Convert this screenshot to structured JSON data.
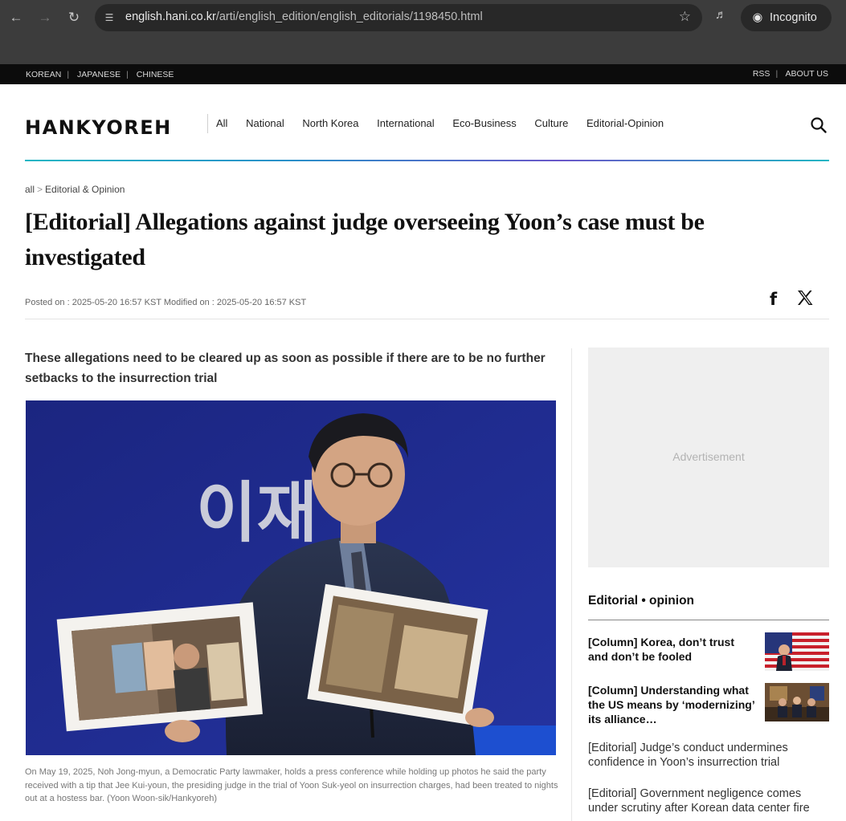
{
  "browser": {
    "url_host": "english.hani.co.kr",
    "url_path": "/arti/english_edition/english_editorials/1198450.html",
    "incognito_label": "Incognito"
  },
  "topbar": {
    "languages": [
      "KOREAN",
      "JAPANESE",
      "CHINESE"
    ],
    "links": [
      "RSS",
      "ABOUT US"
    ]
  },
  "header": {
    "logo": "HANKYOREH",
    "nav": [
      "All",
      "National",
      "North Korea",
      "International",
      "Eco-Business",
      "Culture",
      "Editorial-Opinion"
    ]
  },
  "article": {
    "breadcrumb": [
      "all",
      "Editorial & Opinion"
    ],
    "title": "[Editorial] Allegations against judge overseeing Yoon’s case must be investigated",
    "posted": "Posted on : 2025-05-20 16:57 KST Modified on : 2025-05-20 16:57 KST",
    "subhead": "These allegations need to be cleared up as soon as possible if there are to be no further setbacks to the insurrection trial",
    "photo_sign_text": "이재",
    "caption": "On May 19, 2025, Noh Jong-myun, a Democratic Party lawmaker, holds a press conference while holding up photos he said the party received with a tip that Jee Kui-youn, the presiding judge in the trial of Yoon Suk-yeol on insurrection charges, had been treated to nights out at a hostess bar. (Yoon Woon-sik/Hankyoreh)"
  },
  "sidebar": {
    "ad_label": "Advertisement",
    "heading": "Editorial • opinion",
    "items": [
      {
        "text": "[Column] Korea, don’t trust and don’t be fooled"
      },
      {
        "text": "[Column] Understanding what the US means by ‘modernizing’ its alliance…"
      },
      {
        "text": "[Editorial] Judge’s conduct undermines confidence in Yoon’s insurrection trial"
      },
      {
        "text": "[Editorial] Government negligence comes under scrutiny after Korean data center fire"
      }
    ]
  },
  "colors": {
    "photo_backdrop": "#1f2a86",
    "header_rule": "#1fb6c4",
    "topbar": "#0c0c0c"
  }
}
